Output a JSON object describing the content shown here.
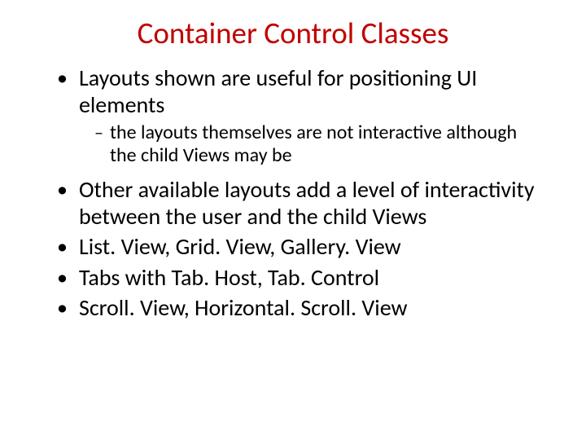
{
  "title": "Container Control Classes",
  "bullets": {
    "b1": "Layouts shown are useful for positioning UI elements",
    "b1_sub1": "the layouts themselves are not interactive although the child Views may be",
    "b2": "Other available layouts add a level of interactivity between the user and the child Views",
    "b3": "List. View, Grid. View, Gallery. View",
    "b4": "Tabs with Tab. Host, Tab. Control",
    "b5": "Scroll. View, Horizontal. Scroll. View"
  },
  "markers": {
    "l1": "•",
    "l2": "–"
  }
}
